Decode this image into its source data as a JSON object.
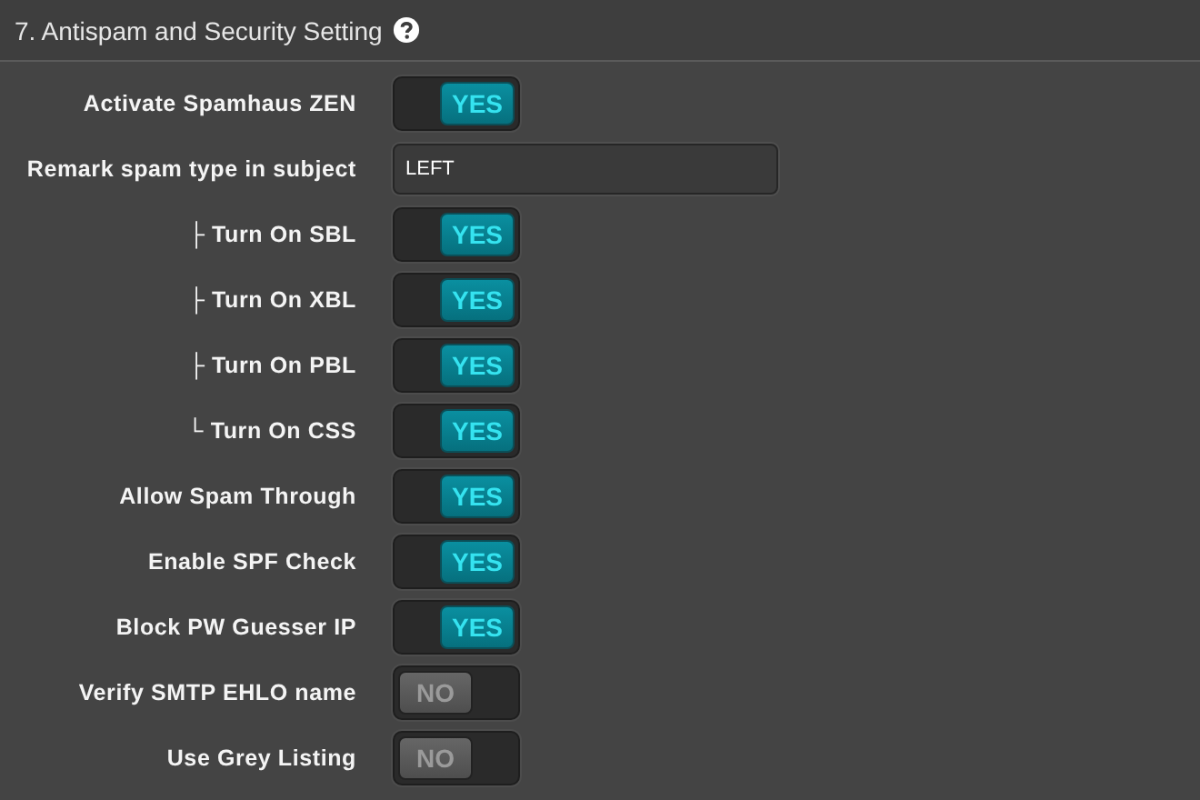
{
  "section": {
    "title": "7. Antispam and Security Setting"
  },
  "rows": [
    {
      "kind": "toggle",
      "label": "Activate Spamhaus ZEN",
      "on": true,
      "knob": "YES"
    },
    {
      "kind": "text",
      "label": "Remark spam type in subject",
      "value": "LEFT"
    },
    {
      "kind": "toggle",
      "label": "├ Turn On SBL",
      "on": true,
      "knob": "YES"
    },
    {
      "kind": "toggle",
      "label": "├ Turn On XBL",
      "on": true,
      "knob": "YES"
    },
    {
      "kind": "toggle",
      "label": "├ Turn On PBL",
      "on": true,
      "knob": "YES"
    },
    {
      "kind": "toggle",
      "label": "└ Turn On CSS",
      "on": true,
      "knob": "YES"
    },
    {
      "kind": "toggle",
      "label": "Allow Spam Through",
      "on": true,
      "knob": "YES"
    },
    {
      "kind": "toggle",
      "label": "Enable SPF Check",
      "on": true,
      "knob": "YES"
    },
    {
      "kind": "toggle",
      "label": "Block PW Guesser IP",
      "on": true,
      "knob": "YES"
    },
    {
      "kind": "toggle",
      "label": "Verify SMTP EHLO name",
      "on": false,
      "knob": "NO"
    },
    {
      "kind": "toggle",
      "label": "Use Grey Listing",
      "on": false,
      "knob": "NO"
    }
  ]
}
